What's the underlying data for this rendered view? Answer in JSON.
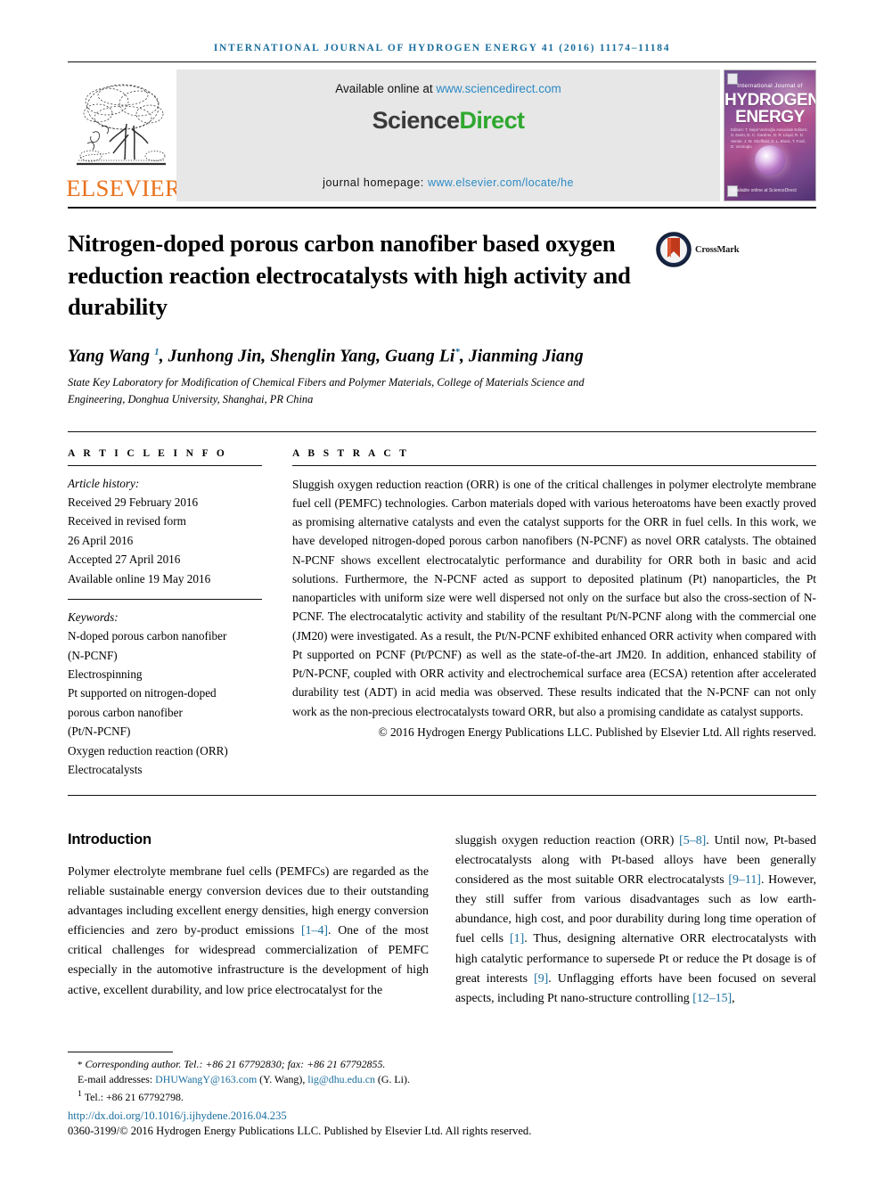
{
  "running_head": "INTERNATIONAL JOURNAL OF HYDROGEN ENERGY 41 (2016) 11174–11184",
  "masthead": {
    "available_label": "Available online at",
    "available_url": "www.sciencedirect.com",
    "sciencedirect_part1": "Science",
    "sciencedirect_part2": "Direct",
    "homepage_label": "journal homepage:",
    "homepage_url": "www.elsevier.com/locate/he",
    "publisher_wordmark": "ELSEVIER",
    "cover": {
      "line_top": "International Journal of",
      "line_1": "HYDROGEN",
      "line_2": "ENERGY",
      "editors": "Editors: T. Nejat Veziroğlu\nAssociate Editors: S. Dunn, D. C. Gardner, D. R. Lloyd, R. D. Venter, J. W. Sheffield, D. L. Block, T. Ford, D. Veziroglu",
      "footer": "Available online at\nScienceDirect"
    }
  },
  "article": {
    "title": "Nitrogen-doped porous carbon nanofiber based oxygen reduction reaction electrocatalysts with high activity and durability",
    "crossmark_label": "CrossMark",
    "authors_html": "Yang Wang <sup class=\"blue\">1</sup>, Junhong Jin, Shenglin Yang, Guang Li<sup class=\"blue\">*</sup>, Jianming Jiang",
    "affiliation": "State Key Laboratory for Modification of Chemical Fibers and Polymer Materials, College of Materials Science and Engineering, Donghua University, Shanghai, PR China"
  },
  "info": {
    "heading": "A R T I C L E   I N F O",
    "history_label": "Article history:",
    "history": [
      "Received 29 February 2016",
      "Received in revised form",
      "26 April 2016",
      "Accepted 27 April 2016",
      "Available online 19 May 2016"
    ],
    "keywords_label": "Keywords:",
    "keywords": [
      "N-doped porous carbon nanofiber",
      "(N-PCNF)",
      "Electrospinning",
      "Pt supported on nitrogen-doped",
      "porous carbon nanofiber",
      "(Pt/N-PCNF)",
      "Oxygen reduction reaction (ORR)",
      "Electrocatalysts"
    ]
  },
  "abstract": {
    "heading": "A B S T R A C T",
    "text": "Sluggish oxygen reduction reaction (ORR) is one of the critical challenges in polymer electrolyte membrane fuel cell (PEMFC) technologies. Carbon materials doped with various heteroatoms have been exactly proved as promising alternative catalysts and even the catalyst supports for the ORR in fuel cells. In this work, we have developed nitrogen-doped porous carbon nanofibers (N-PCNF) as novel ORR catalysts. The obtained N-PCNF shows excellent electrocatalytic performance and durability for ORR both in basic and acid solutions. Furthermore, the N-PCNF acted as support to deposited platinum (Pt) nanoparticles, the Pt nanoparticles with uniform size were well dispersed not only on the surface but also the cross-section of N-PCNF. The electrocatalytic activity and stability of the resultant Pt/N-PCNF along with the commercial one (JM20) were investigated. As a result, the Pt/N-PCNF exhibited enhanced ORR activity when compared with Pt supported on PCNF (Pt/PCNF) as well as the state-of-the-art JM20. In addition, enhanced stability of Pt/N-PCNF, coupled with ORR activity and electrochemical surface area (ECSA) retention after accelerated durability test (ADT) in acid media was observed. These results indicated that the N-PCNF can not only work as the non-precious electrocatalysts toward ORR, but also a promising candidate as catalyst supports.",
    "copyright": "© 2016 Hydrogen Energy Publications LLC. Published by Elsevier Ltd. All rights reserved."
  },
  "body": {
    "section_title": "Introduction",
    "left_html": "Polymer electrolyte membrane fuel cells (PEMFCs) are regarded as the reliable sustainable energy conversion devices due to their outstanding advantages including excellent energy densities, high energy conversion efficiencies and zero by-product emissions <span class=\"ref\">[1&ndash;4]</span>. One of the most critical challenges for widespread commercialization of PEMFC especially in the automotive infrastructure is the development of high active, excellent durability, and low price electrocatalyst for the",
    "right_html": "sluggish oxygen reduction reaction (ORR) <span class=\"ref\">[5&ndash;8]</span>. Until now, Pt-based electrocatalysts along with Pt-based alloys have been generally considered as the most suitable ORR electrocatalysts <span class=\"ref\">[9&ndash;11]</span>. However, they still suffer from various disadvantages such as low earth-abundance, high cost, and poor durability during long time operation of fuel cells <span class=\"ref\">[1]</span>. Thus, designing alternative ORR electrocatalysts with high catalytic performance to supersede Pt or reduce the Pt dosage is of great interests <span class=\"ref\">[9]</span>. Unflagging efforts have been focused on several aspects, including Pt nano-structure controlling <span class=\"ref\">[12&ndash;15]</span>,"
  },
  "footnotes": {
    "corresponding_html": "<span class=\"star\">*</span> <i>Corresponding author. Tel.: +86 21 67792830; fax: +86 21 67792855.</i>",
    "email_html": "E-mail addresses: <span class=\"link\">DHUWangY@163.com</span> (Y. Wang), <span class=\"link\">lig@dhu.edu.cn</span> (G. Li).",
    "tel_html": "<sup>1</sup> Tel.: +86 21 67792798.",
    "doi": "http://dx.doi.org/10.1016/j.ijhydene.2016.04.235",
    "issn_html": "0360-3199/© 2016 Hydrogen Energy Publications LLC. Published by Elsevier Ltd. All rights reserved."
  },
  "colors": {
    "link_blue": "#1a6e9e",
    "sciencedirect_green": "#2fa82f",
    "elsevier_orange": "#E9711C"
  }
}
